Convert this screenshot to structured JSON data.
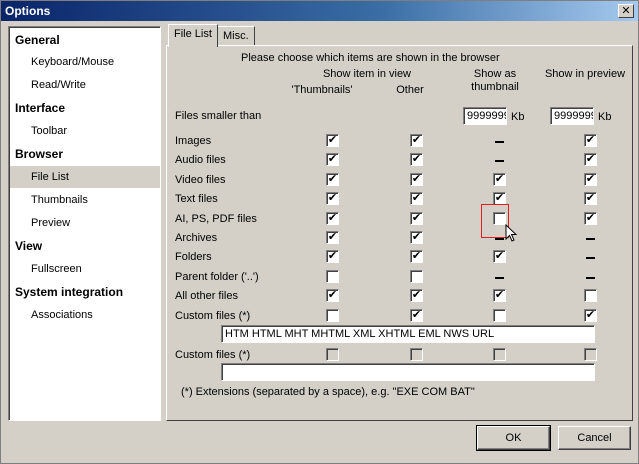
{
  "window": {
    "title": "Options",
    "close_glyph": "✕"
  },
  "sidebar": {
    "sections": [
      {
        "title": "General",
        "items": [
          "Keyboard/Mouse",
          "Read/Write"
        ]
      },
      {
        "title": "Interface",
        "items": [
          "Toolbar"
        ]
      },
      {
        "title": "Browser",
        "items": [
          "File List",
          "Thumbnails",
          "Preview"
        ]
      },
      {
        "title": "View",
        "items": [
          "Fullscreen"
        ]
      },
      {
        "title": "System integration",
        "items": [
          "Associations"
        ]
      }
    ],
    "selected": "File List"
  },
  "tabs": [
    {
      "label": "File List",
      "active": true
    },
    {
      "label": "Misc.",
      "active": false
    }
  ],
  "panel": {
    "intro": "Please choose which items are shown in the browser",
    "headers": {
      "show_in_view": "Show item in view",
      "thumbnails": "'Thumbnails'",
      "other": "Other",
      "show_as_thumb_1": "Show as",
      "show_as_thumb_2": "thumbnail",
      "show_in_preview": "Show in preview"
    },
    "files_smaller": {
      "label": "Files smaller than",
      "thumb_value": "9999999",
      "preview_value": "9999999",
      "unit": "Kb"
    },
    "rows": [
      {
        "label": "Images",
        "thumb": "checked",
        "other": "checked",
        "as_thumb": "dash",
        "preview": "checked"
      },
      {
        "label": "Audio files",
        "thumb": "checked",
        "other": "checked",
        "as_thumb": "dash",
        "preview": "checked"
      },
      {
        "label": "Video files",
        "thumb": "checked",
        "other": "checked",
        "as_thumb": "checked",
        "preview": "checked"
      },
      {
        "label": "Text files",
        "thumb": "checked",
        "other": "checked",
        "as_thumb": "checked",
        "preview": "checked"
      },
      {
        "label": "AI, PS, PDF files",
        "thumb": "checked",
        "other": "checked",
        "as_thumb": "unchecked",
        "preview": "checked"
      },
      {
        "label": "Archives",
        "thumb": "checked",
        "other": "checked",
        "as_thumb": "dash",
        "preview": "dash"
      },
      {
        "label": "Folders",
        "thumb": "checked",
        "other": "checked",
        "as_thumb": "checked",
        "preview": "dash"
      },
      {
        "label": "Parent folder ('..')",
        "thumb": "unchecked",
        "other": "unchecked",
        "as_thumb": "dash",
        "preview": "dash"
      },
      {
        "label": "All other files",
        "thumb": "checked",
        "other": "checked",
        "as_thumb": "checked",
        "preview": "unchecked"
      },
      {
        "label": "Custom files (*)",
        "thumb": "unchecked",
        "other": "checked",
        "as_thumb": "unchecked",
        "preview": "checked"
      }
    ],
    "custom1_value": "HTM HTML MHT MHTML XML XHTML EML NWS URL",
    "custom2": {
      "label": "Custom files (*)",
      "value": ""
    },
    "footnote": "(*) Extensions (separated by a space), e.g. \"EXE COM BAT\""
  },
  "buttons": {
    "ok": "OK",
    "cancel": "Cancel"
  },
  "check_glyph": "✔"
}
